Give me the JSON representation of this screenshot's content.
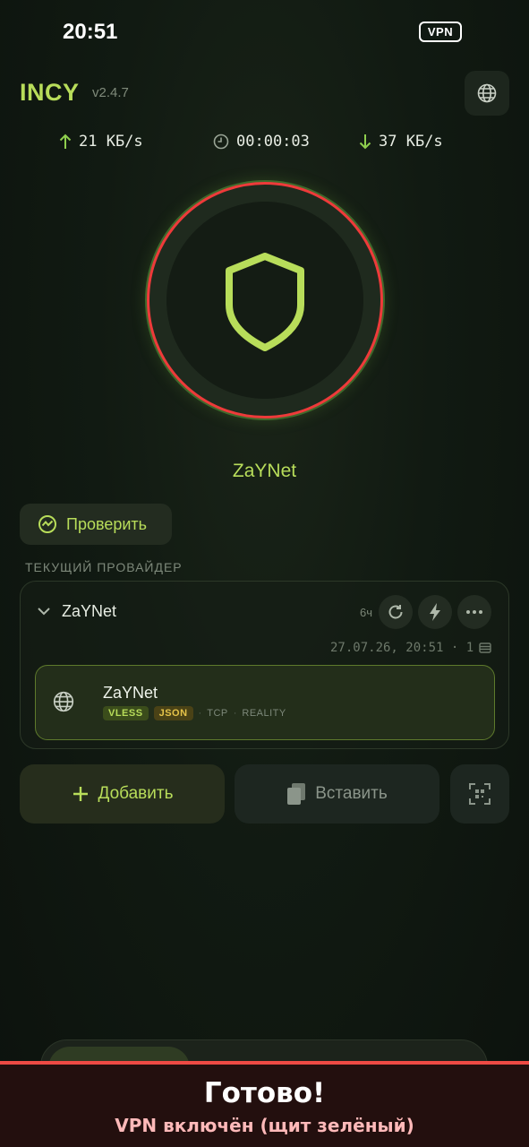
{
  "status_bar": {
    "time": "20:51",
    "vpn_badge": "VPN"
  },
  "header": {
    "brand": "INCY",
    "version": "v2.4.7",
    "globe_icon": "globe-icon"
  },
  "stats": {
    "upload": "21 КБ/s",
    "timer": "00:00:03",
    "download": "37 КБ/s"
  },
  "shield": {
    "state": "connected",
    "shield_color": "#b8dd5a",
    "ring_color": "#ee3a3a"
  },
  "connection": {
    "server_name": "ZaYNet"
  },
  "check_button": {
    "label": "Проверить"
  },
  "provider_section": {
    "label": "ТЕКУЩИЙ ПРОВАЙДЕР",
    "provider": {
      "name": "ZaYNet",
      "age": "6ч",
      "meta": "27.07.26, 20:51 · 1",
      "server": {
        "name": "ZaYNet",
        "tags": [
          "VLESS",
          "JSON"
        ],
        "transport": "TCP",
        "security": "REALITY"
      }
    }
  },
  "actions": {
    "add_label": "Добавить",
    "paste_label": "Вставить"
  },
  "banner": {
    "title": "Готово!",
    "subtitle": "VPN включён (щит зелёный)"
  },
  "colors": {
    "accent": "#b8dd5a",
    "alert": "#ee4a44",
    "bg": "#111a12"
  }
}
